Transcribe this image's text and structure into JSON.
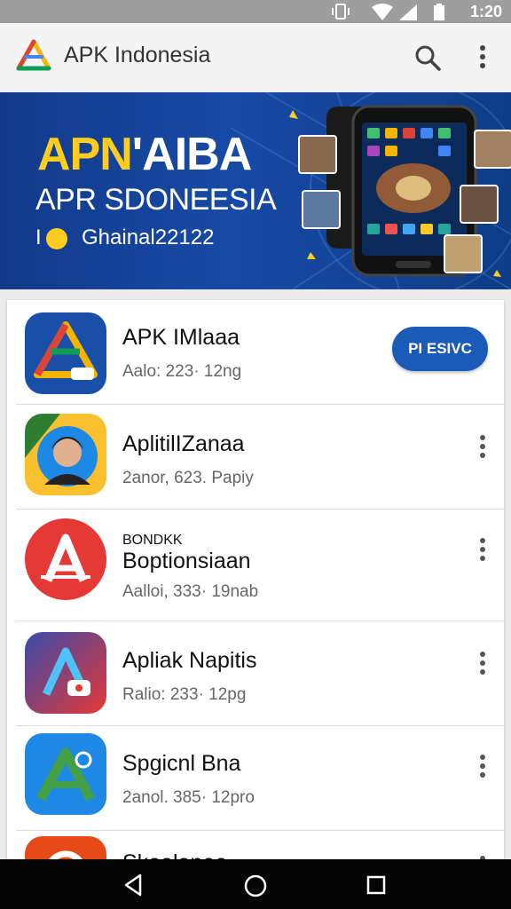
{
  "status_bar": {
    "time": "1:20"
  },
  "app_bar": {
    "title": "APK Indonesia",
    "search_icon": "search-icon",
    "more_icon": "more-vert-icon"
  },
  "banner": {
    "headline_part1": "APN",
    "headline_part2": "'AIBA",
    "subheadline": "APR SDONEESIA",
    "tagline_prefix": "I",
    "tagline": "Ghainal22122"
  },
  "apps": [
    {
      "name": "APK IMlaaa",
      "meta": "Aalo:  223· 12ng",
      "action": "PI ESIVC",
      "icon": "triangle-logo-icon"
    },
    {
      "name": "AplitilIZanaa",
      "meta": "2anor, 623. Papiy",
      "icon": "avatar-icon"
    },
    {
      "name_small": "BONDKK",
      "name": "Boptionsiaan",
      "meta": "Aalloi,  333· 19nab",
      "icon": "red-a-icon"
    },
    {
      "name": "Apliak Napitis",
      "meta": "Ralio:  233· 12pg",
      "icon": "blue-a-icon"
    },
    {
      "name": "Spgicnl Bna",
      "meta": "2anol.  385· 12pro",
      "icon": "green-a-icon"
    },
    {
      "name": "Skoalanee",
      "meta": "",
      "icon": "red-square-icon"
    }
  ],
  "nav": {
    "back_icon": "back-icon",
    "home_icon": "home-icon",
    "recents_icon": "recents-icon"
  },
  "colors": {
    "primary": "#1a5bb8",
    "banner": "#174aa6",
    "accent_yellow": "#ffcc1f"
  }
}
